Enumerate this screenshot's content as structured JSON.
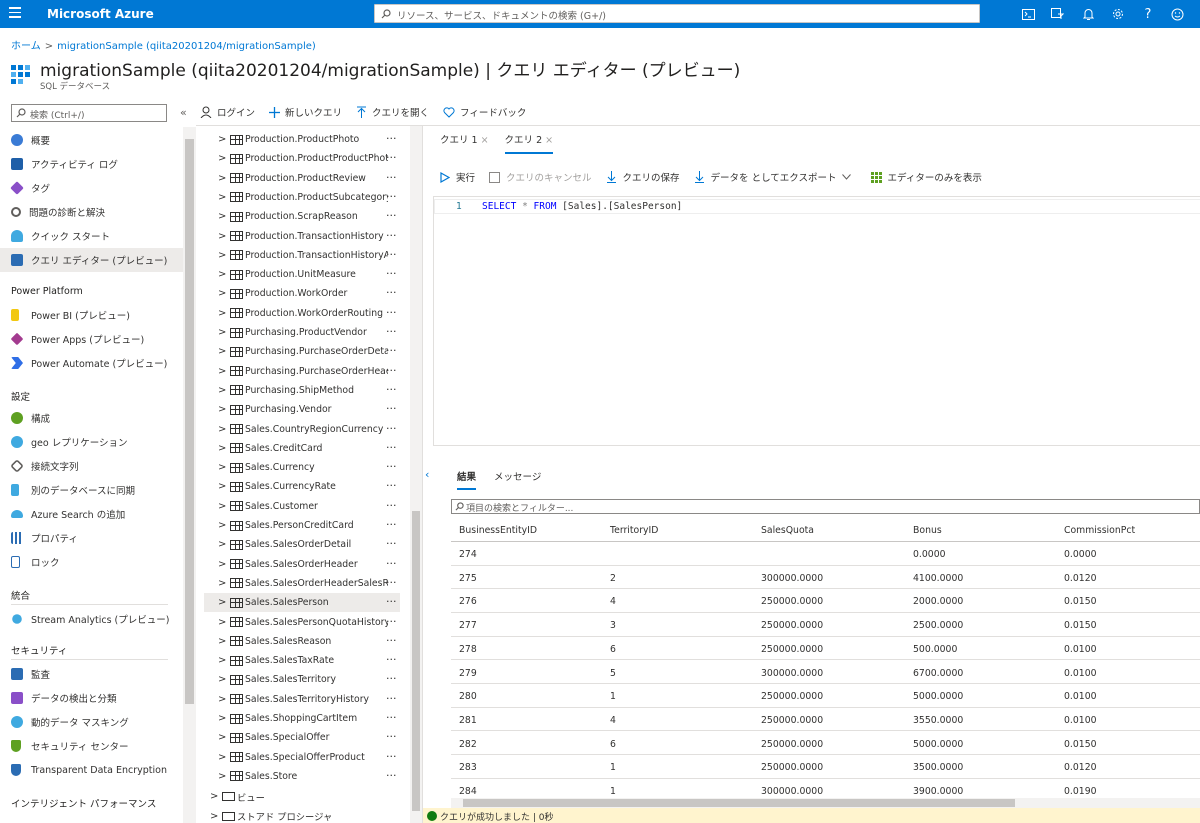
{
  "app": {
    "brand": "Microsoft Azure",
    "search_placeholder": "リソース、サービス、ドキュメントの検索 (G+/)"
  },
  "topbar_icons": [
    "cloud-shell-icon",
    "directory-filter-icon",
    "bell-icon",
    "gear-icon",
    "help-icon",
    "feedback-smiley-icon"
  ],
  "breadcrumb": {
    "home": "ホーム",
    "current": "migrationSample (qiita20201204/migrationSample)"
  },
  "header": {
    "title": "migrationSample (qiita20201204/migrationSample) | クエリ エディター (プレビュー)",
    "subtitle": "SQL データベース"
  },
  "nav": {
    "search_placeholder": "検索 (Ctrl+/)",
    "collapse": "«",
    "items": [
      {
        "label": "概要",
        "icon": "overview-icon",
        "color": "#3a7bd5"
      },
      {
        "label": "アクティビティ ログ",
        "icon": "activity-log-icon",
        "color": "#1f5fa8"
      },
      {
        "label": "タグ",
        "icon": "tag-icon",
        "color": "#8a4fc8"
      },
      {
        "label": "問題の診断と解決",
        "icon": "wrench-icon",
        "color": "#605e5c"
      },
      {
        "label": "クイック スタート",
        "icon": "quickstart-icon",
        "color": "#3fa9e0"
      },
      {
        "label": "クエリ エディター (プレビュー)",
        "icon": "query-editor-icon",
        "color": "#2b6cb3"
      }
    ],
    "section_power": "Power Platform",
    "power_items": [
      {
        "label": "Power BI (プレビュー)",
        "icon": "power-bi-icon",
        "color": "#f2c811"
      },
      {
        "label": "Power Apps (プレビュー)",
        "icon": "power-apps-icon",
        "color": "#a33b8f"
      },
      {
        "label": "Power Automate (プレビュー)",
        "icon": "power-automate-icon",
        "color": "#2f6ee6"
      }
    ],
    "section_settings": "設定",
    "settings_items": [
      {
        "label": "構成",
        "icon": "configuration-icon",
        "color": "#5ea021"
      },
      {
        "label": "geo レプリケーション",
        "icon": "geo-replication-icon",
        "color": "#3fa9e0"
      },
      {
        "label": "接続文字列",
        "icon": "connection-string-icon",
        "color": "#605e5c"
      },
      {
        "label": "別のデータベースに同期",
        "icon": "sync-icon",
        "color": "#3fa9e0"
      },
      {
        "label": "Azure Search の追加",
        "icon": "azure-search-icon",
        "color": "#3fa9e0"
      },
      {
        "label": "プロパティ",
        "icon": "properties-icon",
        "color": "#2b6cb3"
      },
      {
        "label": "ロック",
        "icon": "lock-icon",
        "color": "#2b6cb3"
      }
    ],
    "section_integration": "統合",
    "integration_items": [
      {
        "label": "Stream Analytics (プレビュー)",
        "icon": "stream-analytics-icon",
        "color": "#3fa9e0"
      }
    ],
    "section_security": "セキュリティ",
    "security_items": [
      {
        "label": "監査",
        "icon": "audit-icon",
        "color": "#2b6cb3"
      },
      {
        "label": "データの検出と分類",
        "icon": "data-classification-icon",
        "color": "#8a4fc8"
      },
      {
        "label": "動的データ マスキング",
        "icon": "data-masking-icon",
        "color": "#3fa9e0"
      },
      {
        "label": "セキュリティ センター",
        "icon": "security-center-icon",
        "color": "#5ea021"
      },
      {
        "label": "Transparent Data Encryption",
        "icon": "tde-icon",
        "color": "#2b6cb3"
      }
    ],
    "section_performance": "インテリジェント パフォーマンス"
  },
  "toolbar": {
    "login": "ログイン",
    "new_query": "新しいクエリ",
    "open_query": "クエリを開く",
    "feedback": "フィードバック"
  },
  "tree": {
    "tables": [
      "Production.ProductPhoto",
      "Production.ProductProductPhoto",
      "Production.ProductReview",
      "Production.ProductSubcategory",
      "Production.ScrapReason",
      "Production.TransactionHistory",
      "Production.TransactionHistoryArchive",
      "Production.UnitMeasure",
      "Production.WorkOrder",
      "Production.WorkOrderRouting",
      "Purchasing.ProductVendor",
      "Purchasing.PurchaseOrderDetail",
      "Purchasing.PurchaseOrderHeader",
      "Purchasing.ShipMethod",
      "Purchasing.Vendor",
      "Sales.CountryRegionCurrency",
      "Sales.CreditCard",
      "Sales.Currency",
      "Sales.CurrencyRate",
      "Sales.Customer",
      "Sales.PersonCreditCard",
      "Sales.SalesOrderDetail",
      "Sales.SalesOrderHeader",
      "Sales.SalesOrderHeaderSalesReason",
      "Sales.SalesPerson",
      "Sales.SalesPersonQuotaHistory",
      "Sales.SalesReason",
      "Sales.SalesTaxRate",
      "Sales.SalesTerritory",
      "Sales.SalesTerritoryHistory",
      "Sales.ShoppingCartItem",
      "Sales.SpecialOffer",
      "Sales.SpecialOfferProduct",
      "Sales.Store"
    ],
    "selected": "Sales.SalesPerson",
    "folders": [
      "ビュー",
      "ストアド プロシージャ"
    ],
    "more": "···"
  },
  "editor": {
    "tabs": [
      {
        "label": "クエリ 1",
        "active": false
      },
      {
        "label": "クエリ 2",
        "active": true
      }
    ],
    "close": "×",
    "commands": {
      "run": "実行",
      "cancel": "クエリのキャンセル",
      "save": "クエリの保存",
      "export": "データを としてエクスポート",
      "editor_only": "エディターのみを表示"
    },
    "line_number": "1",
    "query": {
      "kw1": "SELECT",
      "star": "*",
      "kw2": "FROM",
      "table": "[Sales].[SalesPerson]"
    }
  },
  "results": {
    "tabs": [
      "結果",
      "メッセージ"
    ],
    "filter_placeholder": "項目の検索とフィルター...",
    "columns": [
      "BusinessEntityID",
      "TerritoryID",
      "SalesQuota",
      "Bonus",
      "CommissionPct"
    ],
    "rows": [
      [
        "274",
        "",
        "",
        "0.0000",
        "0.0000"
      ],
      [
        "275",
        "2",
        "300000.0000",
        "4100.0000",
        "0.0120"
      ],
      [
        "276",
        "4",
        "250000.0000",
        "2000.0000",
        "0.0150"
      ],
      [
        "277",
        "3",
        "250000.0000",
        "2500.0000",
        "0.0150"
      ],
      [
        "278",
        "6",
        "250000.0000",
        "500.0000",
        "0.0100"
      ],
      [
        "279",
        "5",
        "300000.0000",
        "6700.0000",
        "0.0100"
      ],
      [
        "280",
        "1",
        "250000.0000",
        "5000.0000",
        "0.0100"
      ],
      [
        "281",
        "4",
        "250000.0000",
        "3550.0000",
        "0.0100"
      ],
      [
        "282",
        "6",
        "250000.0000",
        "5000.0000",
        "0.0150"
      ],
      [
        "283",
        "1",
        "250000.0000",
        "3500.0000",
        "0.0120"
      ],
      [
        "284",
        "1",
        "300000.0000",
        "3900.0000",
        "0.0190"
      ]
    ],
    "status": "クエリが成功しました | 0秒"
  }
}
